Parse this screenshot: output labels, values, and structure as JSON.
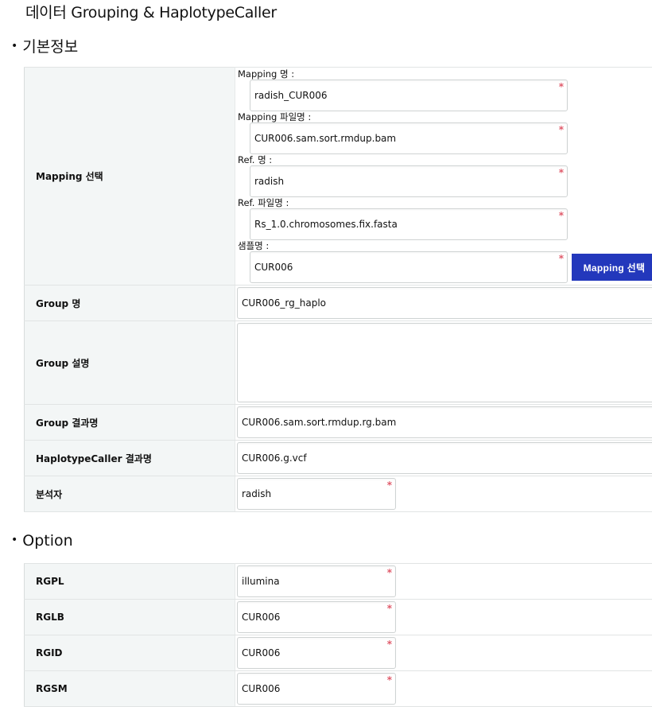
{
  "page": {
    "title": "데이터 Grouping & HaplotypeCaller"
  },
  "sections": {
    "basic": {
      "title": "기본정보",
      "mapping": {
        "label": "Mapping 선택",
        "fields": [
          {
            "label": "Mapping 명 :",
            "value": "radish_CUR006",
            "required": true
          },
          {
            "label": "Mapping 파일명 :",
            "value": "CUR006.sam.sort.rmdup.bam",
            "required": true
          },
          {
            "label": "Ref. 명 :",
            "value": "radish",
            "required": true
          },
          {
            "label": "Ref. 파일명 :",
            "value": "Rs_1.0.chromosomes.fix.fasta",
            "required": true
          },
          {
            "label": "샘플명 :",
            "value": "CUR006",
            "required": true
          }
        ],
        "button_label": "Mapping 선택"
      },
      "rows": [
        {
          "label": "Group 명",
          "value": "CUR006_rg_haplo"
        },
        {
          "label": "Group 설명",
          "value": ""
        },
        {
          "label": "Group 결과명",
          "value": "CUR006.sam.sort.rmdup.rg.bam"
        },
        {
          "label": "HaplotypeCaller 결과명",
          "value": "CUR006.g.vcf"
        },
        {
          "label": "분석자",
          "value": "radish",
          "required": true
        }
      ]
    },
    "option": {
      "title": "Option",
      "rows": [
        {
          "label": "RGPL",
          "value": "illumina",
          "required": true
        },
        {
          "label": "RGLB",
          "value": "CUR006",
          "required": true
        },
        {
          "label": "RGID",
          "value": "CUR006",
          "required": true
        },
        {
          "label": "RGSM",
          "value": "CUR006",
          "required": true
        }
      ]
    }
  },
  "icons": {
    "required_marker": "*",
    "bullet": "•"
  },
  "colors": {
    "button_bg": "#2338bc",
    "label_bg": "#f3f6f6",
    "required": "#e05a6a"
  }
}
